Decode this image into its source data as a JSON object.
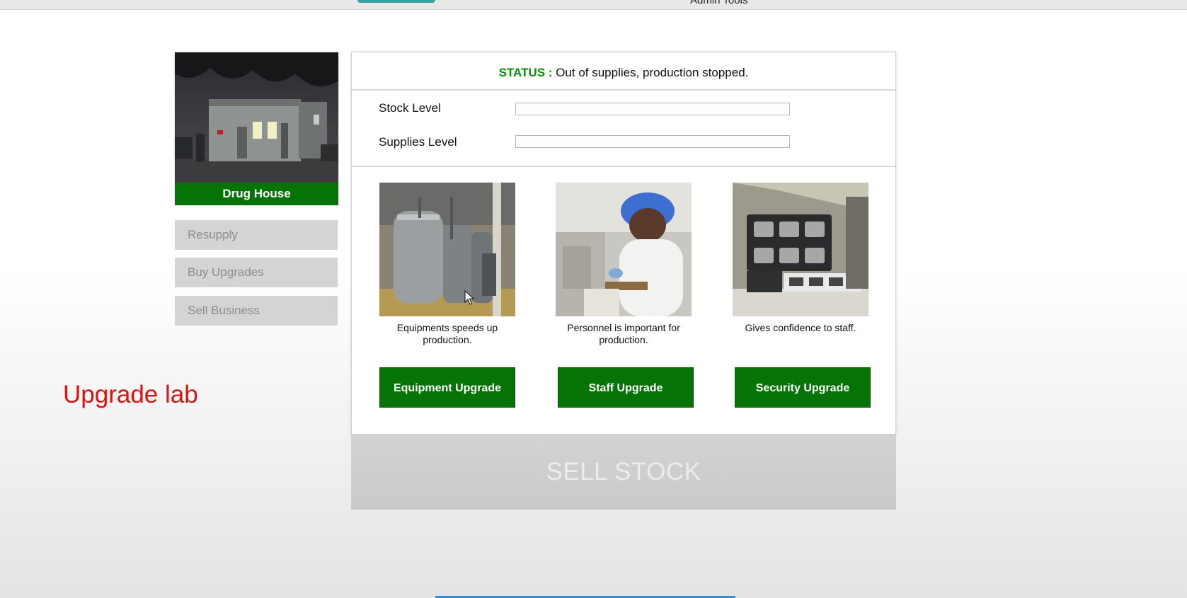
{
  "header": {
    "admin_tools": "Admin Tools"
  },
  "business": {
    "name": "Drug House"
  },
  "sidebar": {
    "items": [
      {
        "label": "Resupply"
      },
      {
        "label": "Buy Upgrades"
      },
      {
        "label": "Sell Business"
      }
    ]
  },
  "caption": "Upgrade lab",
  "status": {
    "label": "STATUS :",
    "text": "Out of supplies, production stopped."
  },
  "levels": [
    {
      "label": "Stock Level",
      "fraction": 0
    },
    {
      "label": "Supplies Level",
      "fraction": 0
    }
  ],
  "upgrades": [
    {
      "description": "Equipments speeds up production.",
      "button": "Equipment Upgrade",
      "icon": "equipment-image"
    },
    {
      "description": "Personnel is important for production.",
      "button": "Staff Upgrade",
      "icon": "staff-image"
    },
    {
      "description": "Gives confidence to staff.",
      "button": "Security Upgrade",
      "icon": "security-image"
    }
  ],
  "sell_stock": "SELL STOCK",
  "colors": {
    "accent_green": "#067306",
    "status_green": "#088a08",
    "disabled_gray": "#d4d4d4",
    "caption_red": "#e01010"
  }
}
